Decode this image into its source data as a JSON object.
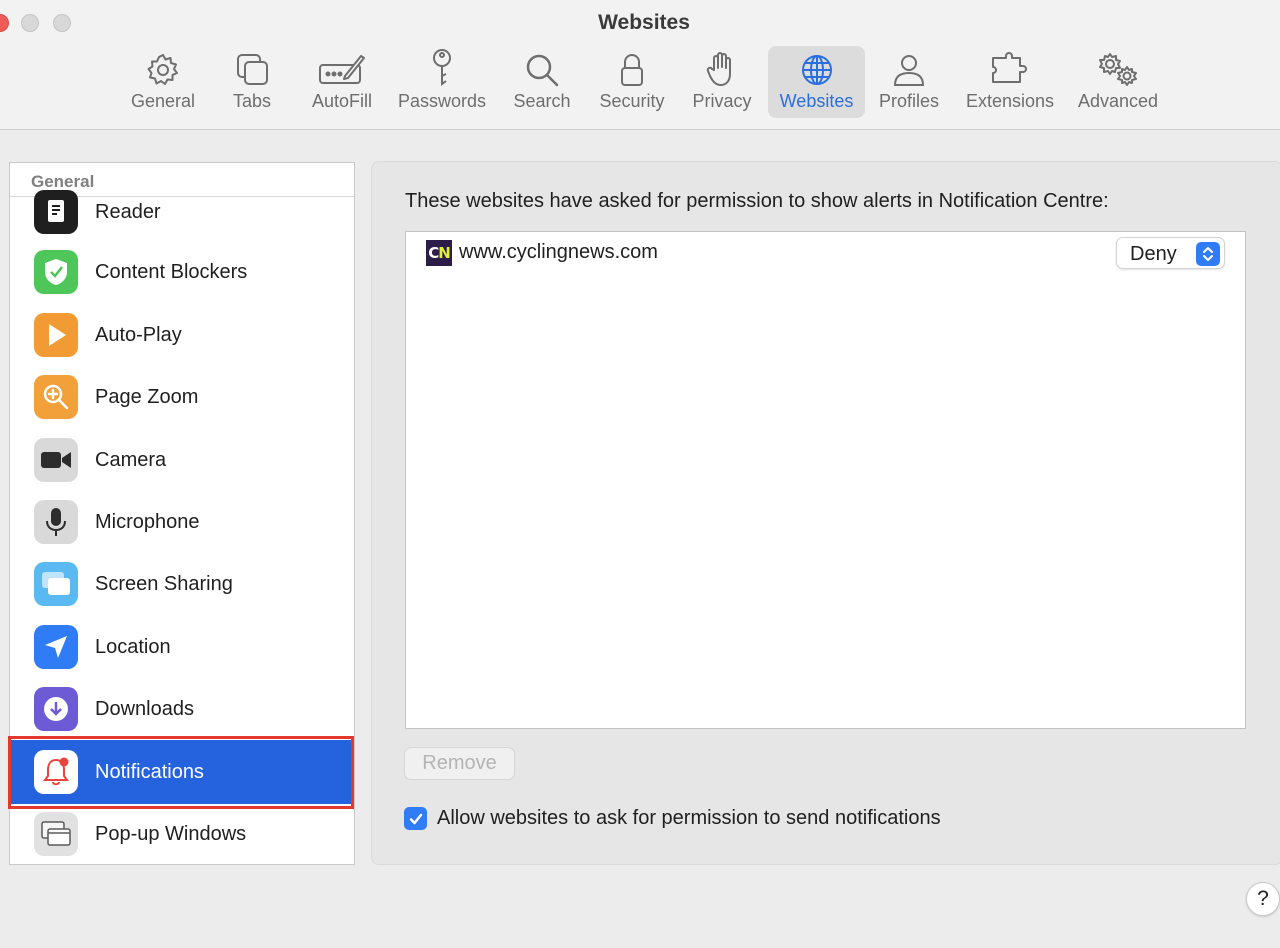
{
  "window": {
    "title": "Websites"
  },
  "toolbar": {
    "tabs": [
      {
        "label": "General",
        "icon": "gear-icon",
        "selected": false
      },
      {
        "label": "Tabs",
        "icon": "tabs-icon",
        "selected": false
      },
      {
        "label": "AutoFill",
        "icon": "autofill-icon",
        "selected": false
      },
      {
        "label": "Passwords",
        "icon": "key-icon",
        "selected": false
      },
      {
        "label": "Search",
        "icon": "search-icon",
        "selected": false
      },
      {
        "label": "Security",
        "icon": "lock-icon",
        "selected": false
      },
      {
        "label": "Privacy",
        "icon": "hand-icon",
        "selected": false
      },
      {
        "label": "Websites",
        "icon": "globe-icon",
        "selected": true
      },
      {
        "label": "Profiles",
        "icon": "person-icon",
        "selected": false
      },
      {
        "label": "Extensions",
        "icon": "puzzle-icon",
        "selected": false
      },
      {
        "label": "Advanced",
        "icon": "gears-icon",
        "selected": false
      }
    ]
  },
  "sidebar": {
    "section_header": "General",
    "items": [
      {
        "label": "Reader",
        "icon": "reader-icon"
      },
      {
        "label": "Content Blockers",
        "icon": "content-blockers-icon"
      },
      {
        "label": "Auto-Play",
        "icon": "play-icon"
      },
      {
        "label": "Page Zoom",
        "icon": "zoom-icon"
      },
      {
        "label": "Camera",
        "icon": "camera-icon"
      },
      {
        "label": "Microphone",
        "icon": "microphone-icon"
      },
      {
        "label": "Screen Sharing",
        "icon": "screen-sharing-icon"
      },
      {
        "label": "Location",
        "icon": "location-icon"
      },
      {
        "label": "Downloads",
        "icon": "downloads-icon"
      },
      {
        "label": "Notifications",
        "icon": "bell-icon",
        "selected": true
      },
      {
        "label": "Pop-up Windows",
        "icon": "popup-windows-icon"
      }
    ]
  },
  "main": {
    "description": "These websites have asked for permission to show alerts in Notification Centre:",
    "websites": [
      {
        "favicon_text": "CN",
        "domain": "www.cyclingnews.com",
        "permission": "Deny"
      }
    ],
    "remove_button": "Remove",
    "allow_checkbox": {
      "label": "Allow websites to ask for permission to send notifications",
      "checked": true
    },
    "help_button": "?"
  },
  "colors": {
    "accent": "#2f7cf6",
    "selection": "#2563de",
    "highlight_outline": "#e2392c"
  }
}
